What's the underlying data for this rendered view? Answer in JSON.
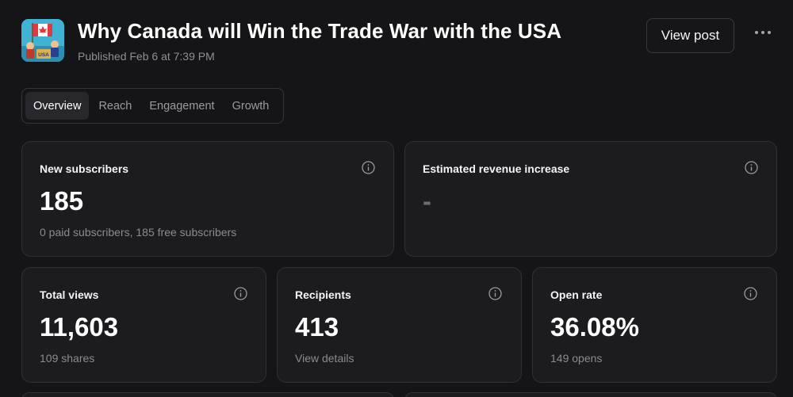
{
  "post": {
    "title": "Why Canada will Win the Trade War with the USA",
    "published": "Published Feb 6 at 7:39 PM",
    "thumbnail_text": "USA"
  },
  "header": {
    "view_post_label": "View post",
    "more_icon": "more-horizontal-icon"
  },
  "tabs": [
    {
      "label": "Overview",
      "active": true
    },
    {
      "label": "Reach",
      "active": false
    },
    {
      "label": "Engagement",
      "active": false
    },
    {
      "label": "Growth",
      "active": false
    }
  ],
  "cards": {
    "new_subscribers": {
      "label": "New subscribers",
      "value": "185",
      "sub": "0 paid subscribers, 185 free subscribers"
    },
    "revenue": {
      "label": "Estimated revenue increase",
      "value": "-"
    },
    "total_views": {
      "label": "Total views",
      "value": "11,603",
      "sub": "109 shares"
    },
    "recipients": {
      "label": "Recipients",
      "value": "413",
      "sub": "View details"
    },
    "open_rate": {
      "label": "Open rate",
      "value": "36.08%",
      "sub": "149 opens"
    }
  },
  "colors": {
    "background": "#151517",
    "card": "#1c1c1f",
    "border": "#303035",
    "text": "#ffffff",
    "muted": "#8a8a90"
  }
}
